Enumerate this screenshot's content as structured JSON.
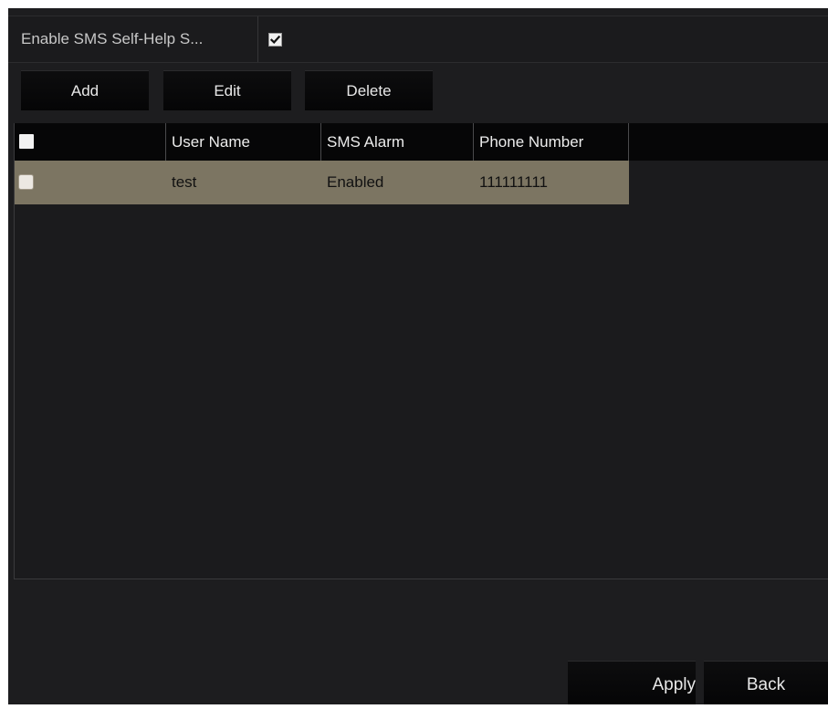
{
  "enable_sms": {
    "label": "Enable SMS Self-Help S...",
    "checked": true
  },
  "toolbar": {
    "add_label": "Add",
    "edit_label": "Edit",
    "delete_label": "Delete"
  },
  "table": {
    "columns": [
      "User Name",
      "SMS Alarm",
      "Phone Number"
    ],
    "rows": [
      {
        "selected": false,
        "user_name": "test",
        "sms_alarm": "Enabled",
        "phone_number": "111111111"
      }
    ]
  },
  "footer": {
    "apply_label": "Apply",
    "back_label": "Back"
  },
  "colors": {
    "background": "#1d1d1f",
    "header_bg": "#060607",
    "selected_row": "#7c7562"
  }
}
